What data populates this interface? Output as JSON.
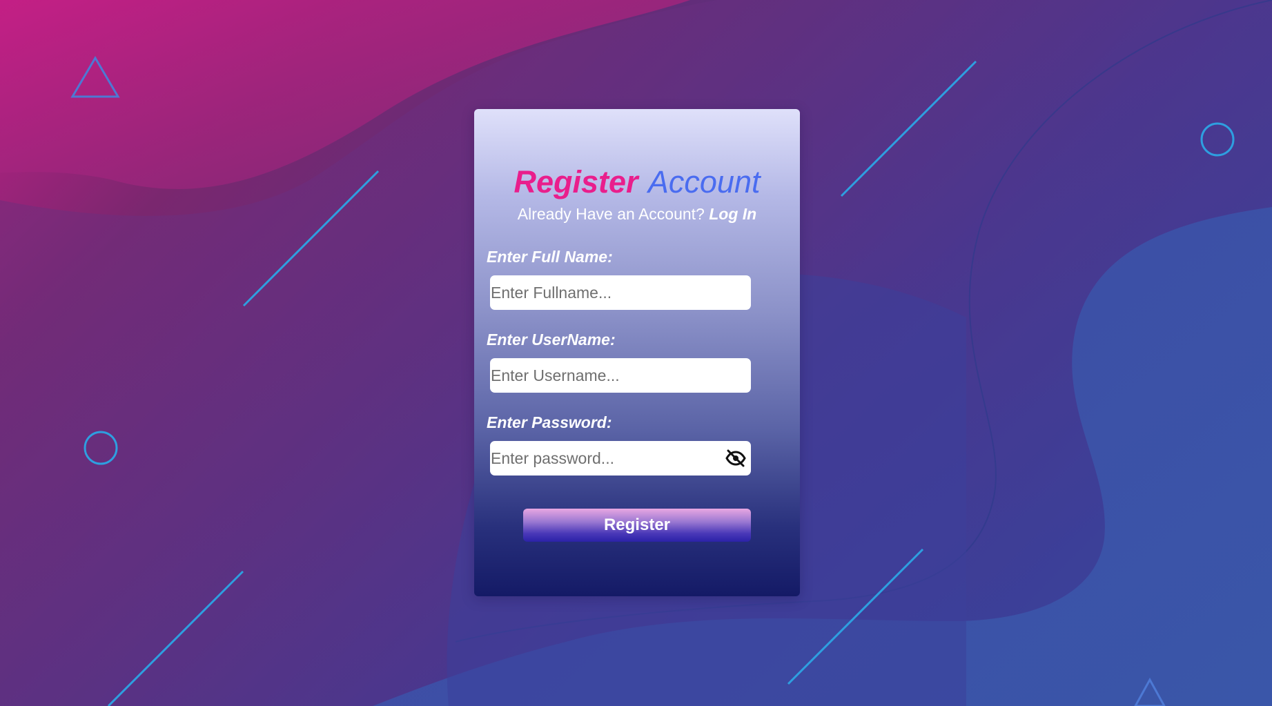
{
  "colors": {
    "brand_pink": "#e91e8c",
    "brand_blue": "#4a6cf0",
    "deco_line": "#2e9fe0"
  },
  "header": {
    "title_strong": "Register",
    "title_light": "Account",
    "subtitle_text": "Already Have an Account?",
    "login_label": "Log In"
  },
  "form": {
    "fullname": {
      "label": "Enter Full Name:",
      "placeholder": "Enter Fullname...",
      "value": ""
    },
    "username": {
      "label": "Enter UserName:",
      "placeholder": "Enter Username...",
      "value": ""
    },
    "password": {
      "label": "Enter Password:",
      "placeholder": "Enter password...",
      "value": "",
      "toggle_icon": "eye-slash-icon"
    },
    "submit_label": "Register"
  },
  "decorations": {
    "shapes": [
      "triangle-outline",
      "circle-outline",
      "diagonal-line"
    ]
  }
}
